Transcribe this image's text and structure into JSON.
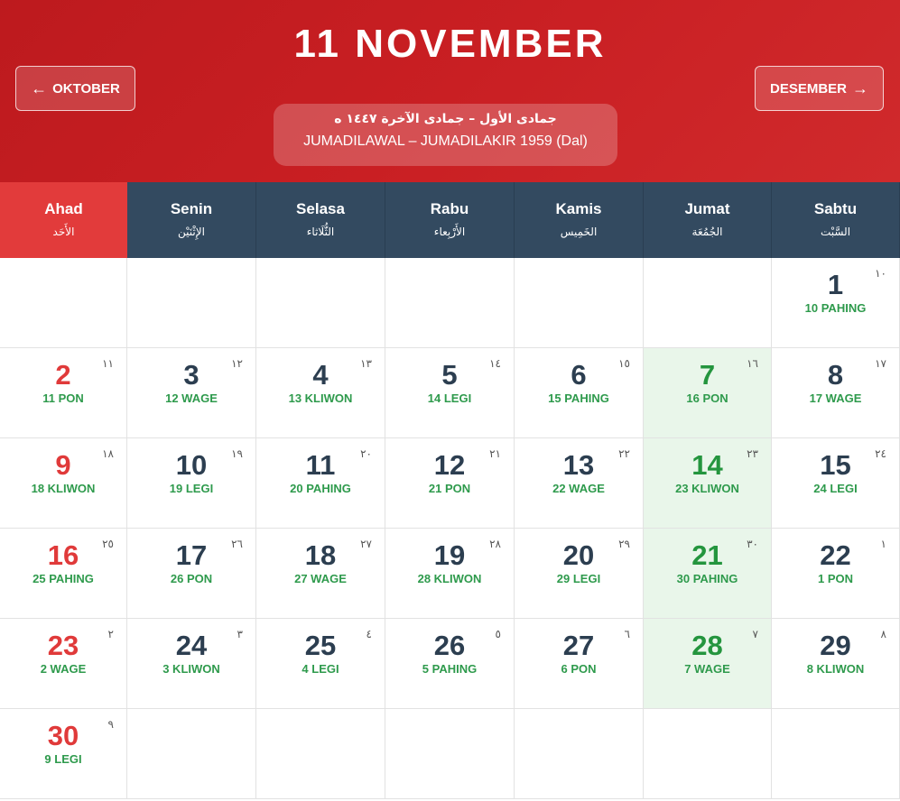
{
  "header": {
    "title": "11 NOVEMBER",
    "prev_label": "OKTOBER",
    "next_label": "DESEMBER",
    "prev_arrow": "←",
    "next_arrow": "→",
    "hijri_arabic": "جمادى الأول – جمادى الآخرة ١٤٤٧ ه",
    "hijri_latin": "JUMADILAWAL – JUMADILAKIR 1959 (Dal)"
  },
  "days": [
    {
      "latin": "Ahad",
      "arabic": "الأَحَد"
    },
    {
      "latin": "Senin",
      "arabic": "الإِثْنَيْن"
    },
    {
      "latin": "Selasa",
      "arabic": "الثُّلَاثاء"
    },
    {
      "latin": "Rabu",
      "arabic": "الأَرْبِعاء"
    },
    {
      "latin": "Kamis",
      "arabic": "الخَمِيس"
    },
    {
      "latin": "Jumat",
      "arabic": "الجُمُعَة"
    },
    {
      "latin": "Sabtu",
      "arabic": "السَّبْت"
    }
  ],
  "weeks": [
    [
      null,
      null,
      null,
      null,
      null,
      null,
      {
        "day": "1",
        "pasaran": "10 PAHING",
        "hijri": "١٠"
      }
    ],
    [
      {
        "day": "2",
        "pasaran": "11 PON",
        "hijri": "١١"
      },
      {
        "day": "3",
        "pasaran": "12 WAGE",
        "hijri": "١٢"
      },
      {
        "day": "4",
        "pasaran": "13 KLIWON",
        "hijri": "١٣"
      },
      {
        "day": "5",
        "pasaran": "14 LEGI",
        "hijri": "١٤"
      },
      {
        "day": "6",
        "pasaran": "15 PAHING",
        "hijri": "١٥"
      },
      {
        "day": "7",
        "pasaran": "16 PON",
        "hijri": "١٦"
      },
      {
        "day": "8",
        "pasaran": "17 WAGE",
        "hijri": "١٧"
      }
    ],
    [
      {
        "day": "9",
        "pasaran": "18 KLIWON",
        "hijri": "١٨"
      },
      {
        "day": "10",
        "pasaran": "19 LEGI",
        "hijri": "١٩"
      },
      {
        "day": "11",
        "pasaran": "20 PAHING",
        "hijri": "٢٠"
      },
      {
        "day": "12",
        "pasaran": "21 PON",
        "hijri": "٢١"
      },
      {
        "day": "13",
        "pasaran": "22 WAGE",
        "hijri": "٢٢"
      },
      {
        "day": "14",
        "pasaran": "23 KLIWON",
        "hijri": "٢٣"
      },
      {
        "day": "15",
        "pasaran": "24 LEGI",
        "hijri": "٢٤"
      }
    ],
    [
      {
        "day": "16",
        "pasaran": "25 PAHING",
        "hijri": "٢٥"
      },
      {
        "day": "17",
        "pasaran": "26 PON",
        "hijri": "٢٦"
      },
      {
        "day": "18",
        "pasaran": "27 WAGE",
        "hijri": "٢٧"
      },
      {
        "day": "19",
        "pasaran": "28 KLIWON",
        "hijri": "٢٨"
      },
      {
        "day": "20",
        "pasaran": "29 LEGI",
        "hijri": "٢٩"
      },
      {
        "day": "21",
        "pasaran": "30 PAHING",
        "hijri": "٣٠"
      },
      {
        "day": "22",
        "pasaran": "1 PON",
        "hijri": "١"
      }
    ],
    [
      {
        "day": "23",
        "pasaran": "2 WAGE",
        "hijri": "٢"
      },
      {
        "day": "24",
        "pasaran": "3 KLIWON",
        "hijri": "٣"
      },
      {
        "day": "25",
        "pasaran": "4 LEGI",
        "hijri": "٤"
      },
      {
        "day": "26",
        "pasaran": "5 PAHING",
        "hijri": "٥"
      },
      {
        "day": "27",
        "pasaran": "6 PON",
        "hijri": "٦"
      },
      {
        "day": "28",
        "pasaran": "7 WAGE",
        "hijri": "٧"
      },
      {
        "day": "29",
        "pasaran": "8 KLIWON",
        "hijri": "٨"
      }
    ],
    [
      {
        "day": "30",
        "pasaran": "9 LEGI",
        "hijri": "٩"
      },
      null,
      null,
      null,
      null,
      null,
      null
    ]
  ],
  "colors": {
    "header_red": "#c91f23",
    "sunday_red": "#e23b3b",
    "weekday_header": "#334a60",
    "friday_green": "#24953e",
    "friday_bg": "#e9f6ea",
    "pasaran_green": "#2e9a4c"
  }
}
